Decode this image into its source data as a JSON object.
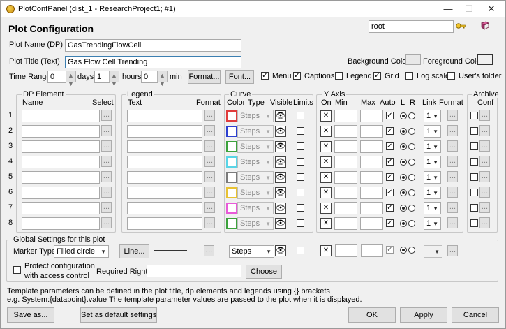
{
  "window": {
    "title": "PlotConfPanel (dist_1 - ResearchProject1; #1)",
    "minimize": "—",
    "maximize": "☐",
    "close": "✕"
  },
  "header": {
    "title": "Plot Configuration",
    "user": "root"
  },
  "plot": {
    "name_label": "Plot Name (DP)",
    "name_value": "GasTrendingFlowCell",
    "title_label": "Plot Title (Text)",
    "title_value": "Gas Flow Cell Trending",
    "bg_color_label": "Background Color",
    "fg_color_label": "Foreground Color"
  },
  "timerange": {
    "label": "Time Range",
    "days": "0",
    "days_label": "days",
    "hours": "1",
    "hours_label": "hours",
    "min": "0",
    "min_label": "min",
    "format_btn": "Format...",
    "font_btn": "Font..."
  },
  "options": [
    {
      "label": "Menu",
      "checked": true
    },
    {
      "label": "Captions",
      "checked": true
    },
    {
      "label": "Legend",
      "checked": false
    },
    {
      "label": "Grid",
      "checked": true
    },
    {
      "label": "Log scale",
      "checked": false
    },
    {
      "label": "User's folder",
      "checked": false
    }
  ],
  "groups": {
    "dp": "DP Element",
    "legend": "Legend",
    "curve": "Curve",
    "yaxis": "Y Axis",
    "archive": "Archive"
  },
  "columns": {
    "name": "Name",
    "select": "Select",
    "text": "Text",
    "format": "Format",
    "color": "Color",
    "type": "Type",
    "visible": "Visible",
    "limits": "Limits",
    "on": "On",
    "min": "Min",
    "max": "Max",
    "auto": "Auto",
    "l": "L",
    "r": "R",
    "link": "Link",
    "format2": "Format",
    "conf": "Conf"
  },
  "rows": [
    {
      "num": "1",
      "color": "#e03c3c",
      "type": "Steps",
      "link": "1"
    },
    {
      "num": "2",
      "color": "#2b3fd0",
      "type": "Steps",
      "link": "1"
    },
    {
      "num": "3",
      "color": "#3ca23c",
      "type": "Steps",
      "link": "1"
    },
    {
      "num": "4",
      "color": "#59d4e6",
      "type": "Steps",
      "link": "1"
    },
    {
      "num": "5",
      "color": "#7a7a7a",
      "type": "Steps",
      "link": "1"
    },
    {
      "num": "6",
      "color": "#e8c233",
      "type": "Steps",
      "link": "1"
    },
    {
      "num": "7",
      "color": "#e85ad8",
      "type": "Steps",
      "link": "1"
    },
    {
      "num": "8",
      "color": "#3ca23c",
      "type": "Steps",
      "link": "1"
    }
  ],
  "global": {
    "title": "Global Settings for this plot",
    "marker_label": "Marker Type:",
    "marker_value": "Filled circle",
    "line_btn": "Line...",
    "type_value": "Steps",
    "protect_label1": "Protect configuration",
    "protect_label2": "with access control",
    "required_right_label": "Required Right:",
    "choose_btn": "Choose"
  },
  "info": {
    "line1": "Template parameters can be defined in the plot title, dp elements and legends using {} brackets",
    "line2": "e.g. System:{datapoint}.value  The template parameter values are passed to the plot when it is displayed."
  },
  "footer": {
    "save_as": "Save as...",
    "default": "Set as default settings",
    "ok": "OK",
    "apply": "Apply",
    "cancel": "Cancel"
  }
}
